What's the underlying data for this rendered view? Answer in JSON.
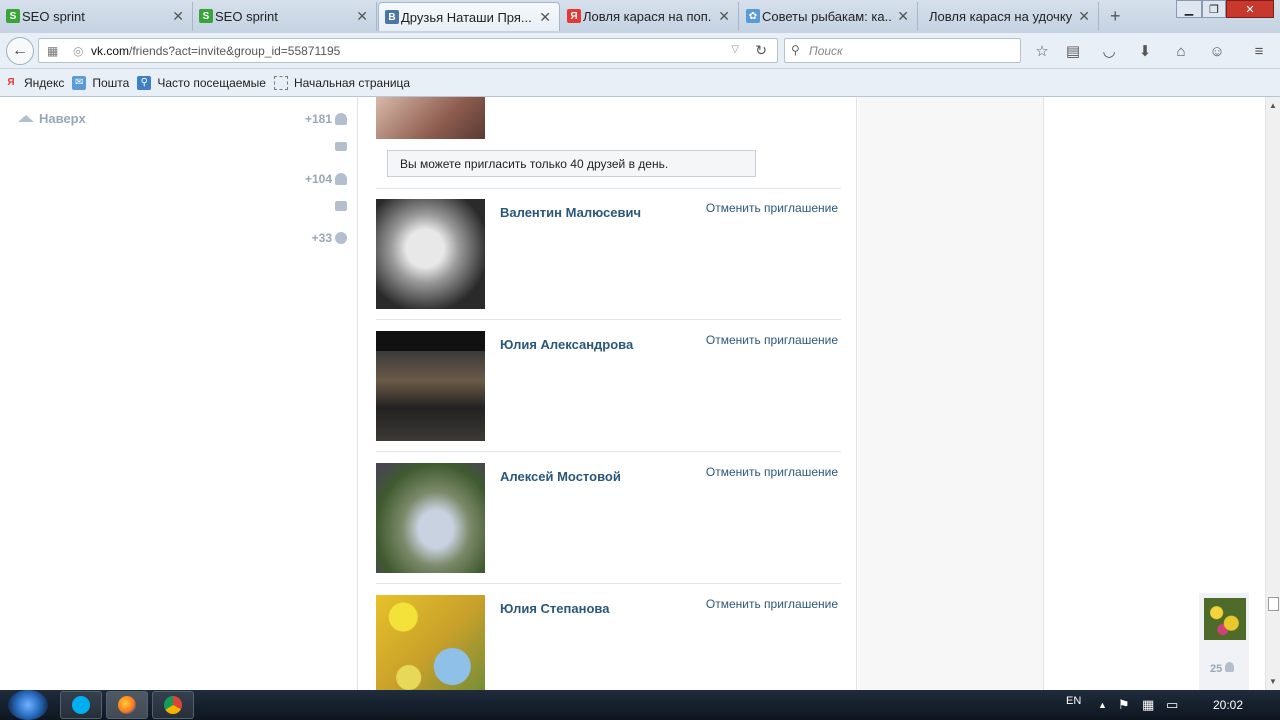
{
  "browser": {
    "tabs": [
      {
        "title": "SEO sprint",
        "favicon": "seo-sprint-icon",
        "active": false
      },
      {
        "title": "SEO sprint",
        "favicon": "seo-sprint-icon",
        "active": false
      },
      {
        "title": "Друзья Наташи Пря...",
        "favicon": "vk-icon",
        "active": true
      },
      {
        "title": "Ловля карася на поп...",
        "favicon": "yandex-icon",
        "active": false
      },
      {
        "title": "Советы рыбакам: ка...",
        "favicon": "site-icon",
        "active": false
      },
      {
        "title": "Ловля карася на удочку ...",
        "favicon": "none",
        "active": false
      }
    ],
    "url_domain": "vk.com",
    "url_path": "/friends?act=invite&group_id=55871195",
    "search_placeholder": "Поиск",
    "bookmarks": [
      {
        "label": "Яндекс",
        "icon": "yandex-icon"
      },
      {
        "label": "Пошта",
        "icon": "mail-icon"
      },
      {
        "label": "Часто посещаемые",
        "icon": "frequent-icon"
      },
      {
        "label": "Начальная страница",
        "icon": "page-icon"
      }
    ]
  },
  "sidebar": {
    "back_to_top": "Наверх",
    "counters": [
      {
        "text": "+181",
        "icon": "user-icon"
      },
      {
        "text": "",
        "icon": "mail-icon"
      },
      {
        "text": "+104",
        "icon": "users-icon"
      },
      {
        "text": "",
        "icon": "comment-icon"
      },
      {
        "text": "+33",
        "icon": "gear-icon"
      }
    ]
  },
  "main": {
    "notice": "Вы можете пригласить только 40 друзей в день.",
    "cancel_label": "Отменить приглашение",
    "friends": [
      {
        "name": "Валентин Малюсевич"
      },
      {
        "name": "Юлия Александрова"
      },
      {
        "name": "Алексей Мостовой"
      },
      {
        "name": "Юлия Степанова"
      }
    ]
  },
  "mini_widget": {
    "count": "25"
  },
  "taskbar": {
    "lang": "EN",
    "time": "20:02"
  },
  "colors": {
    "link": "#2b587a",
    "muted": "#9aa7b8",
    "taskbar": "#0e1620"
  }
}
